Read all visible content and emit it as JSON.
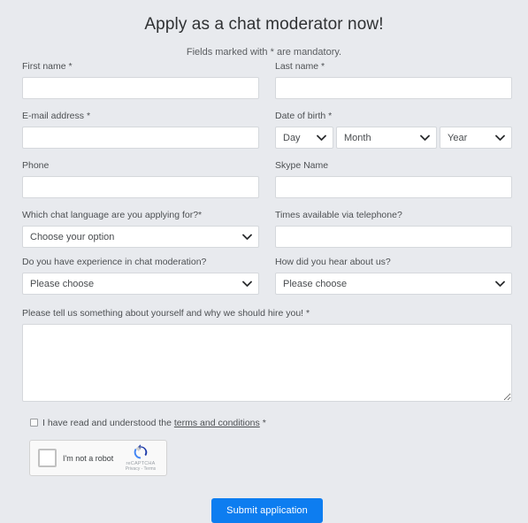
{
  "header": {
    "title": "Apply as a chat moderator now!",
    "subtitle": "Fields marked with * are mandatory."
  },
  "fields": {
    "first_name": {
      "label": "First name *",
      "value": "",
      "placeholder": ""
    },
    "last_name": {
      "label": "Last name *",
      "value": "",
      "placeholder": ""
    },
    "email": {
      "label": "E-mail address *",
      "value": "",
      "placeholder": ""
    },
    "dob": {
      "label": "Date of birth *",
      "day": {
        "selected": "Day",
        "options": [
          "Day"
        ]
      },
      "month": {
        "selected": "Month",
        "options": [
          "Month"
        ]
      },
      "year": {
        "selected": "Year",
        "options": [
          "Year"
        ]
      }
    },
    "phone": {
      "label": "Phone",
      "value": "",
      "placeholder": ""
    },
    "skype": {
      "label": "Skype Name",
      "value": "",
      "placeholder": ""
    },
    "chat_language": {
      "label": "Which chat language are you applying for?*",
      "selected": "Choose your option",
      "options": [
        "Choose your option"
      ]
    },
    "times_available": {
      "label": "Times available via telephone?",
      "value": "",
      "placeholder": ""
    },
    "experience": {
      "label": "Do you have experience in chat moderation?",
      "selected": "Please choose",
      "options": [
        "Please choose"
      ]
    },
    "hear_about": {
      "label": "How did you hear about us?",
      "selected": "Please choose",
      "options": [
        "Please choose"
      ]
    },
    "about_you": {
      "label": "Please tell us something about yourself and why we should hire you! *",
      "value": "",
      "placeholder": ""
    }
  },
  "terms": {
    "text_before": "I have read and understood the",
    "link_text": "terms and conditions",
    "star": "*",
    "checked": false
  },
  "recaptcha": {
    "label": "I'm not a robot",
    "brand": "reCAPTCHA",
    "legal": "Privacy - Terms",
    "logo_color": "#4285f4"
  },
  "submit": {
    "label": "Submit application",
    "color": "#0d7df0"
  },
  "colors": {
    "background": "#e8eaee",
    "field_background": "#ffffff",
    "field_border": "#d5d8dc",
    "label_text": "#4d5053",
    "title_text": "#2f3133"
  }
}
